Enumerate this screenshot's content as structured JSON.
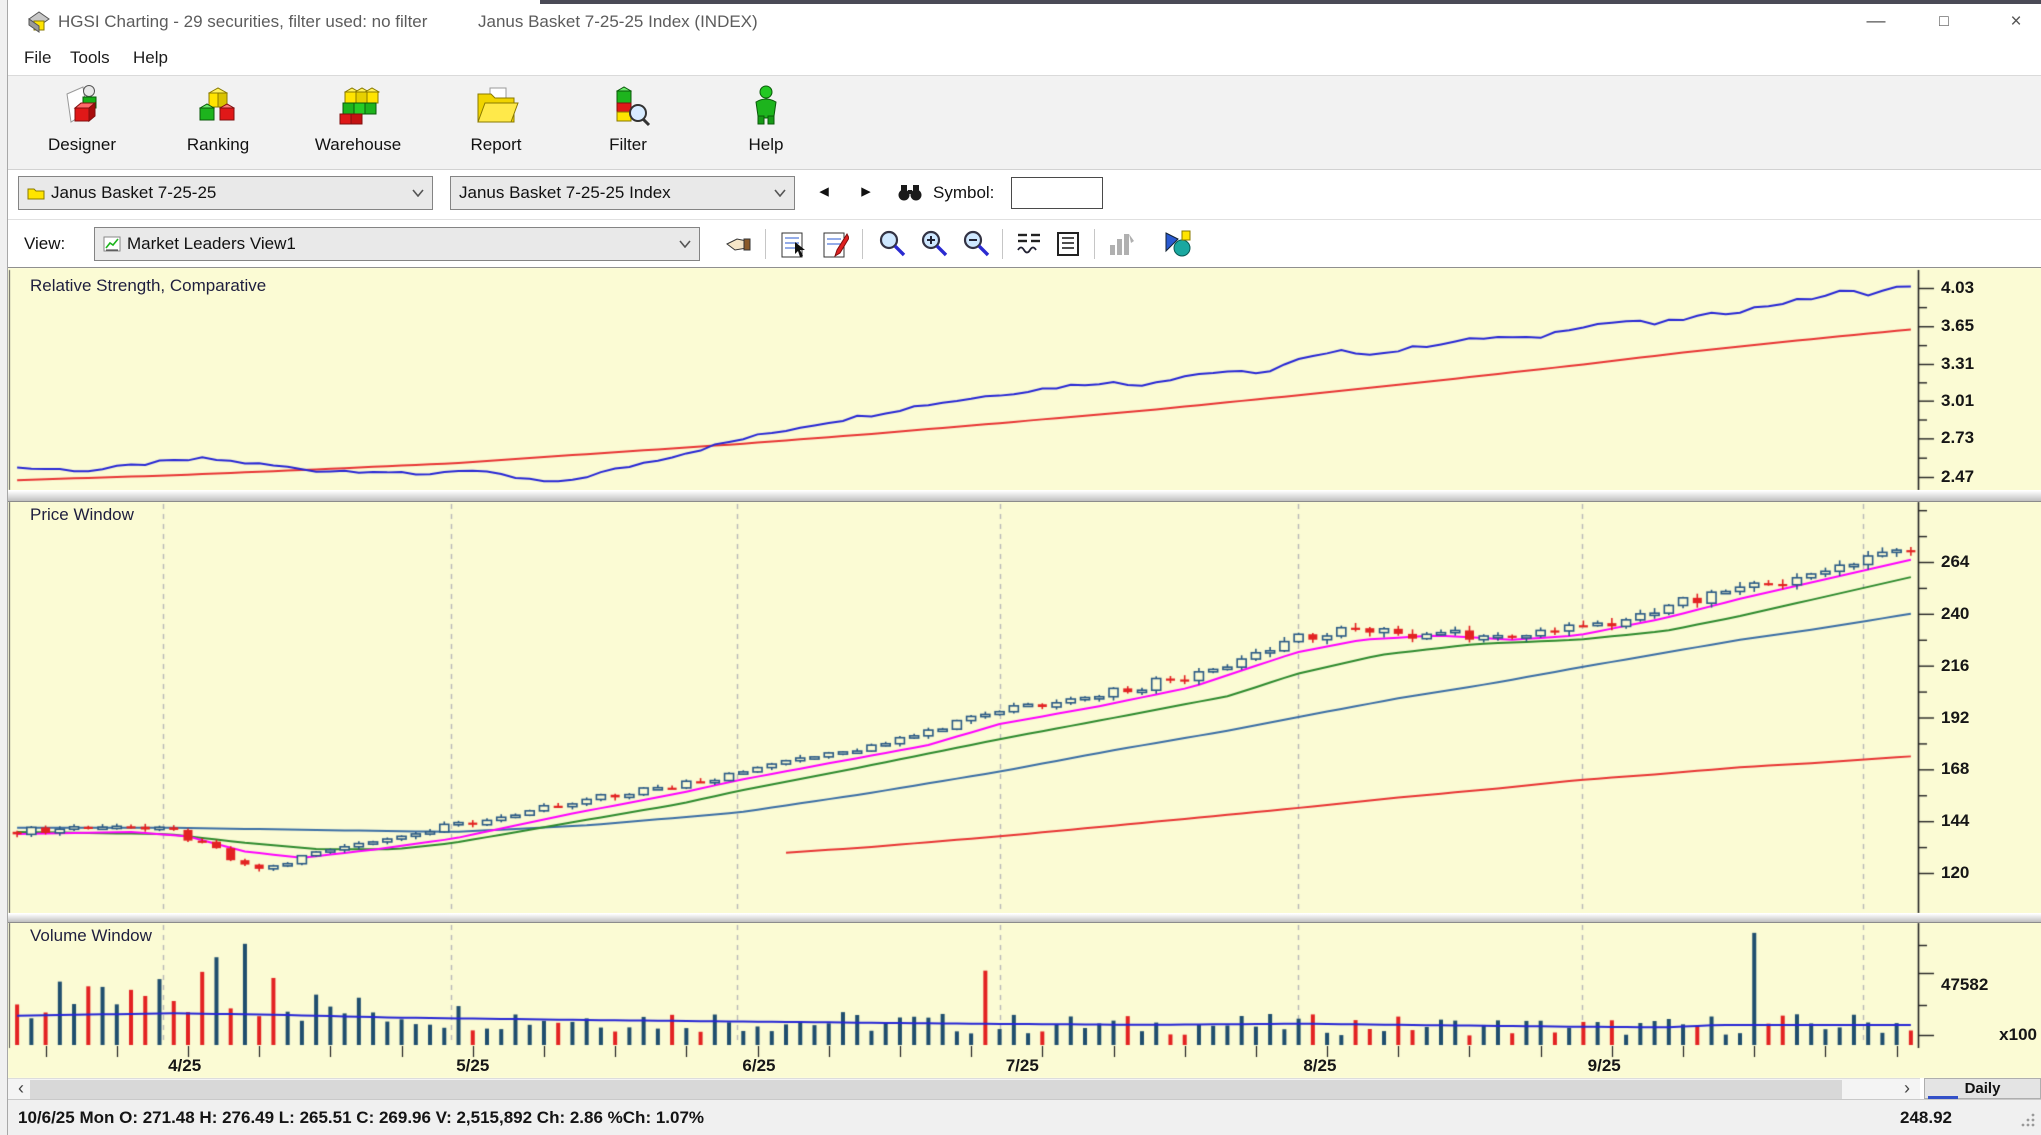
{
  "window": {
    "title": "HGSI Charting - 29 securities, filter used: no filter",
    "document_title": "Janus Basket 7-25-25 Index (INDEX)"
  },
  "menu": {
    "items": [
      {
        "label": "File"
      },
      {
        "label": "Tools"
      },
      {
        "label": "Help"
      }
    ]
  },
  "toolbar": {
    "buttons": [
      {
        "label": "Designer"
      },
      {
        "label": "Ranking"
      },
      {
        "label": "Warehouse"
      },
      {
        "label": "Report"
      },
      {
        "label": "Filter"
      },
      {
        "label": "Help"
      }
    ]
  },
  "selector_bar": {
    "basket_combo": "Janus Basket 7-25-25",
    "index_combo": "Janus Basket 7-25-25 Index",
    "symbol_label": "Symbol:",
    "symbol_value": ""
  },
  "view_bar": {
    "label": "View:",
    "view_combo": "Market Leaders View1"
  },
  "panels": {
    "rs": {
      "title": "Relative Strength, Comparative"
    },
    "price": {
      "title": "Price Window"
    },
    "volume": {
      "title": "Volume Window"
    }
  },
  "bottom": {
    "timeframe": "Daily"
  },
  "status_bar": {
    "quote": "10/6/25 Mon O: 271.48 H: 276.49 L: 265.51 C: 269.96 V: 2,515,892 Ch: 2.86 %Ch: 1.07%",
    "cursor_value": "248.92"
  },
  "colors": {
    "chart_bg": "#fbfbd4",
    "grid": "#b8b8b8",
    "candle_up": "#2a5a85",
    "candle_down": "#e32222",
    "ma_magenta": "#ff00ff",
    "ma_green": "#2d8a2d",
    "ma_blue": "#3a6ea5",
    "ma_red": "#e83333",
    "rs_blue": "#2525d5",
    "rs_red": "#e83333",
    "vol_up": "#1f4e6e",
    "vol_down": "#e32222",
    "vol_ma": "#2525d5"
  },
  "chart_data": {
    "type": "multi-panel",
    "x_axis": {
      "month_labels": [
        "4/25",
        "5/25",
        "6/25",
        "7/25",
        "8/25",
        "9/25"
      ],
      "month_fracs": [
        0.08,
        0.231,
        0.381,
        0.519,
        0.675,
        0.824
      ],
      "extra_gridline_frac": 0.971,
      "weekly_tick_every": 5
    },
    "rs": {
      "type": "line",
      "scale": "log",
      "ylabels": [
        4.03,
        3.65,
        3.31,
        3.01,
        2.73,
        2.47
      ],
      "blue_anchors": [
        [
          0,
          2.53
        ],
        [
          0.04,
          2.51
        ],
        [
          0.07,
          2.56
        ],
        [
          0.1,
          2.59
        ],
        [
          0.13,
          2.55
        ],
        [
          0.16,
          2.51
        ],
        [
          0.19,
          2.51
        ],
        [
          0.21,
          2.48
        ],
        [
          0.235,
          2.52
        ],
        [
          0.26,
          2.47
        ],
        [
          0.285,
          2.43
        ],
        [
          0.32,
          2.53
        ],
        [
          0.35,
          2.62
        ],
        [
          0.381,
          2.72
        ],
        [
          0.42,
          2.83
        ],
        [
          0.45,
          2.9
        ],
        [
          0.48,
          2.98
        ],
        [
          0.519,
          3.06
        ],
        [
          0.55,
          3.12
        ],
        [
          0.575,
          3.16
        ],
        [
          0.59,
          3.13
        ],
        [
          0.62,
          3.22
        ],
        [
          0.64,
          3.25
        ],
        [
          0.655,
          3.22
        ],
        [
          0.675,
          3.34
        ],
        [
          0.7,
          3.42
        ],
        [
          0.72,
          3.4
        ],
        [
          0.75,
          3.49
        ],
        [
          0.78,
          3.55
        ],
        [
          0.8,
          3.53
        ],
        [
          0.824,
          3.65
        ],
        [
          0.85,
          3.7
        ],
        [
          0.865,
          3.67
        ],
        [
          0.89,
          3.75
        ],
        [
          0.91,
          3.8
        ],
        [
          0.93,
          3.87
        ],
        [
          0.95,
          3.93
        ],
        [
          0.965,
          4.0
        ],
        [
          0.978,
          3.97
        ],
        [
          1,
          4.06
        ]
      ],
      "red_anchors": [
        [
          0,
          2.45
        ],
        [
          0.08,
          2.48
        ],
        [
          0.16,
          2.52
        ],
        [
          0.231,
          2.56
        ],
        [
          0.3,
          2.62
        ],
        [
          0.381,
          2.69
        ],
        [
          0.45,
          2.76
        ],
        [
          0.519,
          2.84
        ],
        [
          0.6,
          2.94
        ],
        [
          0.675,
          3.05
        ],
        [
          0.75,
          3.17
        ],
        [
          0.824,
          3.3
        ],
        [
          0.88,
          3.41
        ],
        [
          0.93,
          3.5
        ],
        [
          1,
          3.62
        ]
      ]
    },
    "price": {
      "type": "candlestick",
      "ylabels": [
        264,
        240,
        216,
        192,
        168,
        144,
        120
      ],
      "minor_ticks": [
        288,
        276,
        252,
        228,
        204,
        180,
        156,
        132
      ],
      "ylim": [
        97,
        292
      ],
      "num_candles": 134,
      "close_anchors": [
        [
          0,
          139
        ],
        [
          0.03,
          141
        ],
        [
          0.055,
          142
        ],
        [
          0.08,
          139.5
        ],
        [
          0.1,
          133
        ],
        [
          0.115,
          125
        ],
        [
          0.13,
          121
        ],
        [
          0.145,
          126
        ],
        [
          0.17,
          132
        ],
        [
          0.2,
          137
        ],
        [
          0.231,
          142
        ],
        [
          0.27,
          148
        ],
        [
          0.31,
          155
        ],
        [
          0.35,
          161
        ],
        [
          0.381,
          167
        ],
        [
          0.42,
          174
        ],
        [
          0.46,
          181
        ],
        [
          0.49,
          189
        ],
        [
          0.519,
          196
        ],
        [
          0.55,
          200
        ],
        [
          0.58,
          204
        ],
        [
          0.61,
          210
        ],
        [
          0.64,
          217
        ],
        [
          0.675,
          228
        ],
        [
          0.7,
          232
        ],
        [
          0.73,
          231
        ],
        [
          0.76,
          231
        ],
        [
          0.79,
          229
        ],
        [
          0.824,
          234
        ],
        [
          0.85,
          238
        ],
        [
          0.87,
          243
        ],
        [
          0.89,
          247
        ],
        [
          0.91,
          252
        ],
        [
          0.93,
          255
        ],
        [
          0.95,
          259
        ],
        [
          0.971,
          264
        ],
        [
          0.985,
          268
        ],
        [
          1,
          270
        ]
      ],
      "ma_magenta_anchors": [
        [
          0,
          138
        ],
        [
          0.06,
          139
        ],
        [
          0.09,
          137
        ],
        [
          0.12,
          130
        ],
        [
          0.15,
          127
        ],
        [
          0.19,
          131
        ],
        [
          0.231,
          136
        ],
        [
          0.29,
          147
        ],
        [
          0.35,
          157
        ],
        [
          0.381,
          163
        ],
        [
          0.43,
          171
        ],
        [
          0.48,
          179
        ],
        [
          0.519,
          189
        ],
        [
          0.57,
          197
        ],
        [
          0.62,
          206
        ],
        [
          0.675,
          222
        ],
        [
          0.71,
          228
        ],
        [
          0.75,
          230
        ],
        [
          0.79,
          228
        ],
        [
          0.824,
          230
        ],
        [
          0.87,
          238
        ],
        [
          0.91,
          247
        ],
        [
          0.95,
          255
        ],
        [
          1,
          265
        ]
      ],
      "ma_green_anchors": [
        [
          0,
          139
        ],
        [
          0.08,
          138
        ],
        [
          0.12,
          134
        ],
        [
          0.16,
          131
        ],
        [
          0.2,
          131
        ],
        [
          0.231,
          134
        ],
        [
          0.29,
          143
        ],
        [
          0.35,
          152
        ],
        [
          0.381,
          158
        ],
        [
          0.44,
          168
        ],
        [
          0.519,
          182
        ],
        [
          0.58,
          192
        ],
        [
          0.64,
          202
        ],
        [
          0.675,
          212
        ],
        [
          0.72,
          221
        ],
        [
          0.77,
          226
        ],
        [
          0.824,
          228
        ],
        [
          0.87,
          232
        ],
        [
          0.91,
          239
        ],
        [
          0.95,
          247
        ],
        [
          1,
          257
        ]
      ],
      "ma_blue_anchors": [
        [
          0,
          141
        ],
        [
          0.08,
          141
        ],
        [
          0.15,
          140
        ],
        [
          0.231,
          139
        ],
        [
          0.3,
          142
        ],
        [
          0.381,
          148
        ],
        [
          0.45,
          157
        ],
        [
          0.519,
          167
        ],
        [
          0.58,
          177
        ],
        [
          0.64,
          186
        ],
        [
          0.675,
          192
        ],
        [
          0.73,
          201
        ],
        [
          0.78,
          208
        ],
        [
          0.824,
          215
        ],
        [
          0.87,
          222
        ],
        [
          0.91,
          228
        ],
        [
          0.95,
          233
        ],
        [
          1,
          240
        ]
      ],
      "ma_red_start_frac": 0.4,
      "ma_red_anchors": [
        [
          0.4,
          129
        ],
        [
          0.45,
          132
        ],
        [
          0.519,
          137
        ],
        [
          0.58,
          142
        ],
        [
          0.64,
          147
        ],
        [
          0.675,
          150
        ],
        [
          0.73,
          155
        ],
        [
          0.78,
          159
        ],
        [
          0.824,
          163
        ],
        [
          0.87,
          166
        ],
        [
          0.91,
          169
        ],
        [
          0.95,
          171
        ],
        [
          1,
          174
        ]
      ]
    },
    "volume": {
      "type": "bar",
      "axis_label": "47582",
      "axis_unit": "x100",
      "axis_value": 47582,
      "avg_anchors": [
        [
          0,
          24000
        ],
        [
          0.08,
          26000
        ],
        [
          0.13,
          25000
        ],
        [
          0.2,
          22500
        ],
        [
          0.3,
          20500
        ],
        [
          0.4,
          19000
        ],
        [
          0.5,
          17500
        ],
        [
          0.6,
          16500
        ],
        [
          0.675,
          17500
        ],
        [
          0.75,
          16200
        ],
        [
          0.824,
          15000
        ],
        [
          0.87,
          14500
        ],
        [
          0.9,
          16500
        ],
        [
          1,
          16500
        ]
      ],
      "boost_anchors": [
        [
          0,
          1.1
        ],
        [
          0.07,
          1.4
        ],
        [
          0.12,
          1.5
        ],
        [
          0.17,
          1.2
        ],
        [
          0.25,
          1.05
        ],
        [
          0.4,
          1.0
        ],
        [
          0.6,
          0.95
        ],
        [
          0.8,
          0.95
        ],
        [
          1,
          1.05
        ]
      ],
      "specials": [
        [
          3,
          52000,
          "up"
        ],
        [
          13,
          60000,
          "down"
        ],
        [
          14,
          72000,
          "up"
        ],
        [
          16,
          83000,
          "up"
        ],
        [
          18,
          55000,
          "down"
        ],
        [
          68,
          61000,
          "down"
        ],
        [
          122,
          92000,
          "up"
        ]
      ]
    }
  }
}
